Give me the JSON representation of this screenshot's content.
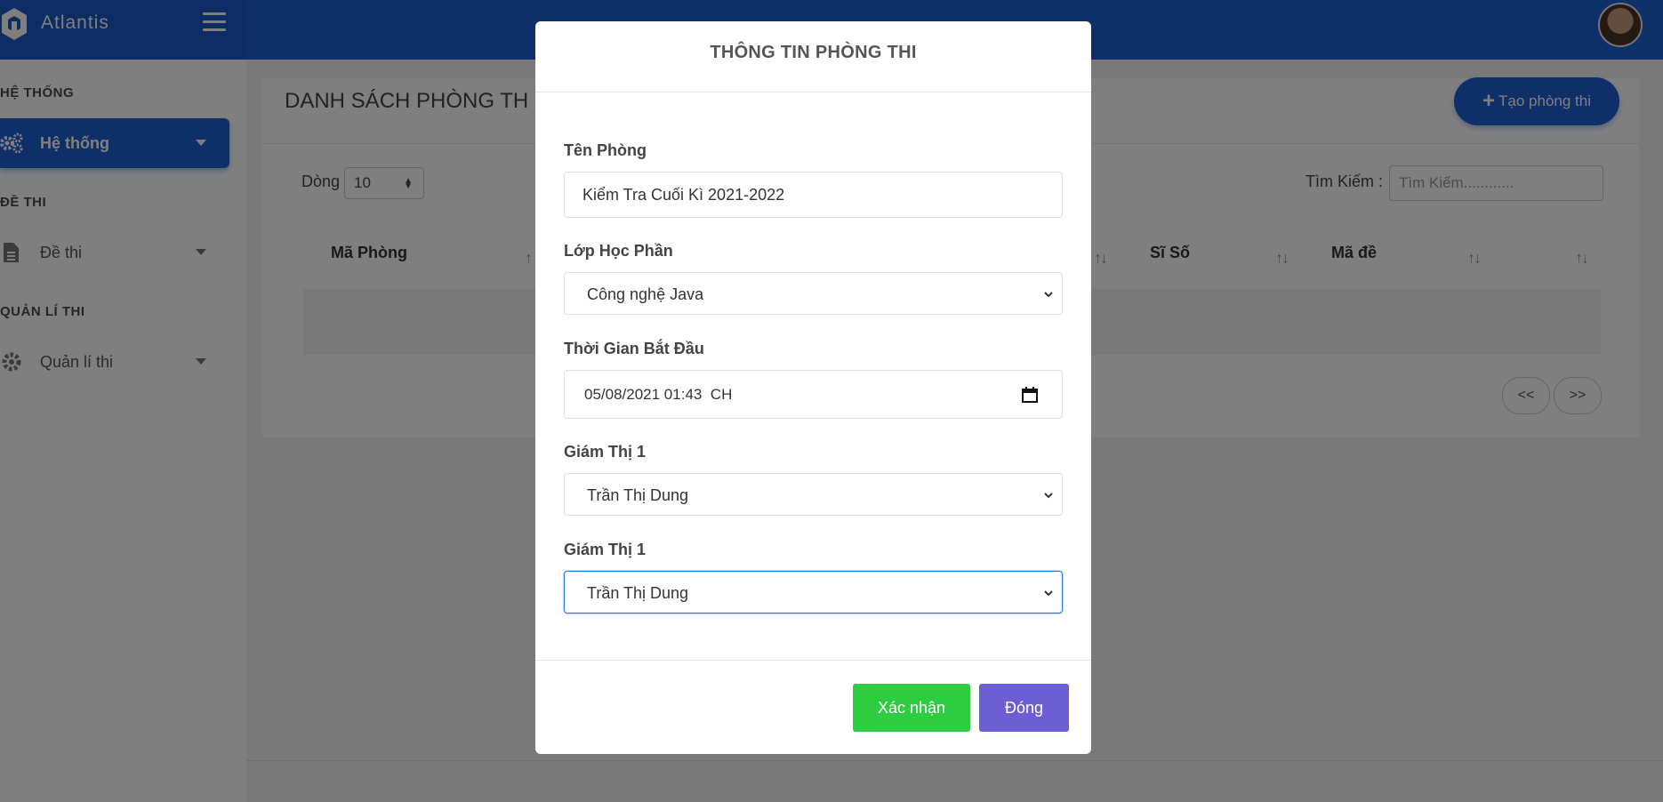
{
  "app": {
    "name": "Atlantis"
  },
  "sidebar": {
    "sections": [
      {
        "title": "HỆ THỐNG",
        "item": {
          "label": "Hệ thống",
          "icon": "gears-icon",
          "active": true
        }
      },
      {
        "title": "ĐỀ THI",
        "item": {
          "label": "Đề thi",
          "icon": "file-icon",
          "active": false
        }
      },
      {
        "title": "QUẢN LÍ THI",
        "item": {
          "label": "Quản lí thi",
          "icon": "gear-icon",
          "active": false
        }
      }
    ]
  },
  "main": {
    "title": "DANH SÁCH PHÒNG TH",
    "create_button": "Tạo phòng thi",
    "rows_label": "Dòng",
    "rows_value": "10",
    "search_label": "Tìm Kiếm :",
    "search_placeholder": "Tìm Kiếm............",
    "columns": [
      "Mã Phòng",
      "Sĩ Số",
      "Mã đề"
    ],
    "pager": {
      "prev": "<<",
      "next": ">>"
    }
  },
  "modal": {
    "title": "THÔNG TIN PHÒNG THI",
    "fields": {
      "room_name": {
        "label": "Tên Phòng",
        "value": "Kiểm Tra Cuối Kì 2021-2022"
      },
      "course": {
        "label": "Lớp Học Phần",
        "value": "Công nghệ Java"
      },
      "start_time": {
        "label": "Thời Gian Bắt Đầu",
        "value": "05/08/2021 01:43  CH"
      },
      "proctor1": {
        "label": "Giám Thị 1",
        "value": "Trần Thị Dung"
      },
      "proctor2": {
        "label": "Giám Thị 1",
        "value": "Trần Thị Dung"
      }
    },
    "confirm_button": "Xác nhận",
    "close_button": "Đóng"
  },
  "colors": {
    "primary": "#1e5fd1",
    "confirm": "#2ecc40",
    "close": "#6c5fd3"
  }
}
